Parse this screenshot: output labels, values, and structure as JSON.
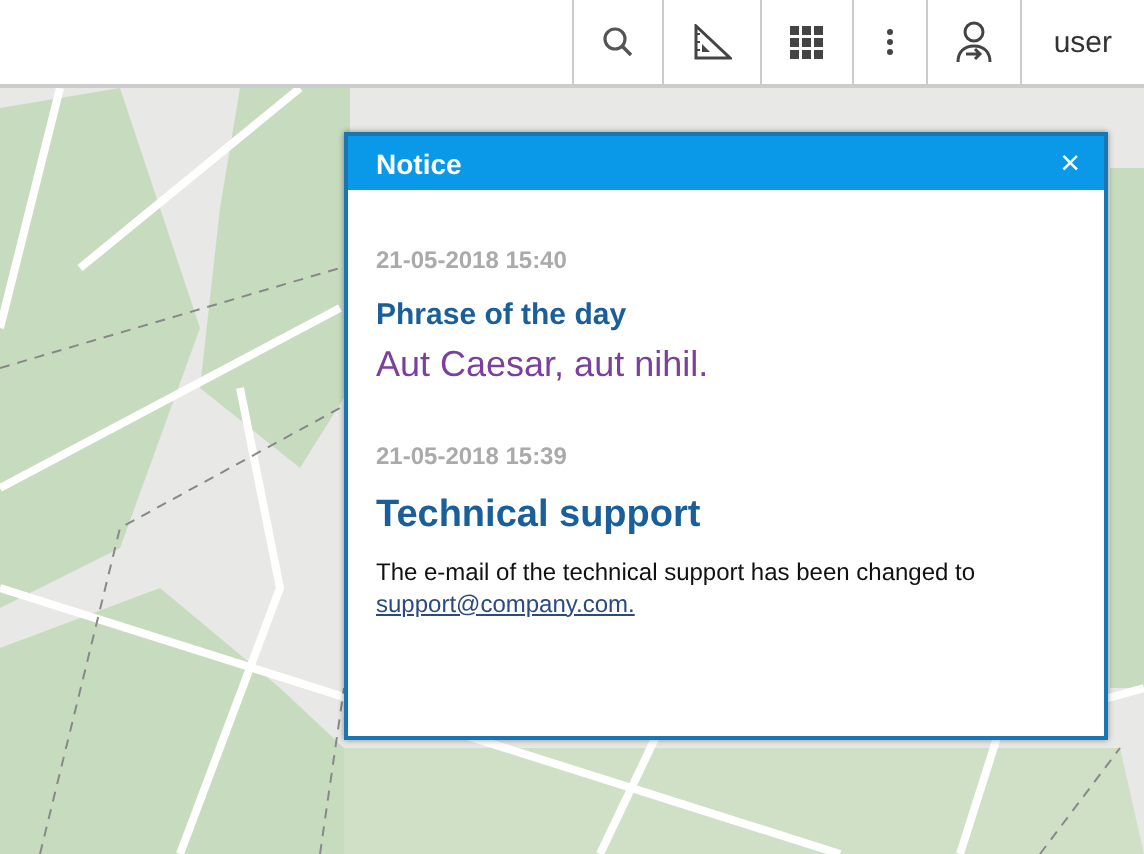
{
  "toolbar": {
    "buttons": [
      {
        "kind": "search"
      },
      {
        "kind": "ruler"
      },
      {
        "kind": "grid"
      },
      {
        "kind": "more"
      },
      {
        "kind": "account"
      }
    ],
    "user": "user"
  },
  "dialog": {
    "title": "Notice",
    "close": "×",
    "messages": [
      {
        "kind": "quote",
        "time": "21-05-2018 15:40",
        "title": "Phrase of the day",
        "text": "Aut Caesar, aut nihil."
      },
      {
        "kind": "text",
        "time": "21-05-2018 15:39",
        "title": "Technical support",
        "text": "The e-mail of the technical support has been changed to",
        "link": "support@company.com."
      }
    ]
  }
}
